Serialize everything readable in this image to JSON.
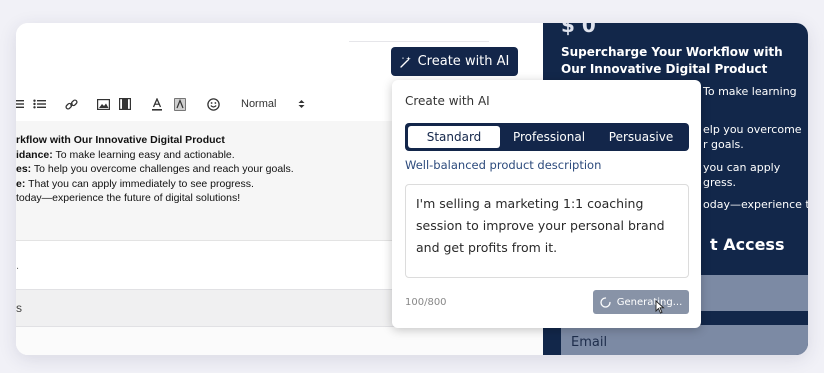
{
  "toolbar": {
    "format_select": "Normal"
  },
  "editor": {
    "heading": "rkflow with Our Innovative Digital Product",
    "lines": [
      {
        "label": "idance:",
        "text": " To make learning easy and actionable."
      },
      {
        "label": "es:",
        "text": " To help you overcome challenges and reach your goals."
      },
      {
        "label": "e:",
        "text": " That you can apply immediately to see progress."
      },
      {
        "label": "",
        "text": "today—experience the future of digital solutions!"
      }
    ],
    "footer_fragment": "s",
    "small_mark": "."
  },
  "ai_button": {
    "label": "Create with AI",
    "icon": "magic-wand-icon"
  },
  "sales_panel": {
    "price": "$ 0",
    "headline": "Supercharge Your Workflow with Our Innovative Digital Product",
    "fragments": [
      "To make learning",
      "elp you overcome",
      "r goals.",
      "you can apply",
      "gress.",
      "oday—experience the"
    ],
    "access_title": "t Access",
    "email_placeholder": "Email"
  },
  "ai_popover": {
    "title": "Create with AI",
    "tabs": [
      {
        "label": "Standard",
        "active": true
      },
      {
        "label": "Professional",
        "active": false
      },
      {
        "label": "Persuasive",
        "active": false
      }
    ],
    "description": "Well-balanced product description",
    "prompt_value": "I'm selling a marketing 1:1 coaching session to improve your personal brand and get profits from it.",
    "char_count": "100/800",
    "generate_label": "Generating..."
  },
  "colors": {
    "navy": "#13264a",
    "panel_navy": "#12274a",
    "field": "#7c8aa4",
    "link_blue": "#2c4a7c"
  }
}
